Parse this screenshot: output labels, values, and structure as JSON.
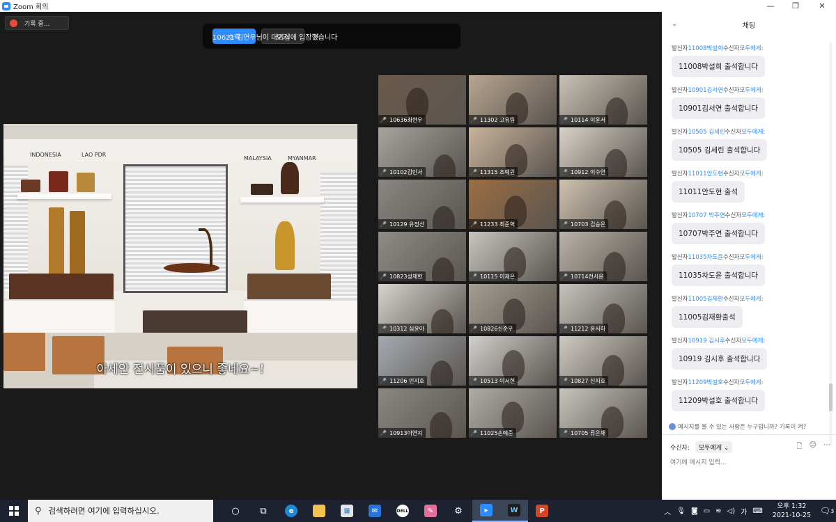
{
  "window": {
    "title": "Zoom 회의",
    "minimize": "—",
    "maximize": "❐",
    "close": "✕"
  },
  "recording": {
    "label": "기록 중..."
  },
  "waiting_room": {
    "message": "10621 김연우님이 대기실에 입장했습니다",
    "admit_label": "수락",
    "view_label": "보기",
    "close": "×"
  },
  "shared_screen": {
    "labels": [
      "INDONESIA",
      "LAO PDR",
      "MALAYSIA",
      "MYANMAR"
    ],
    "caption": "아세안 전시품이 있으니 좋네요~!"
  },
  "participants": [
    {
      "name": "10636최현우",
      "bg": "#6b5a4a"
    },
    {
      "name": "11302 고유림",
      "bg": "#b7a58f"
    },
    {
      "name": "10114 이윤서",
      "bg": "#c9c2b5"
    },
    {
      "name": "10102김민서",
      "bg": "#a7a39d"
    },
    {
      "name": "11315 조예원",
      "bg": "#c9b39a"
    },
    {
      "name": "10912 이수연",
      "bg": "#d8d2c8"
    },
    {
      "name": "10129 유정선",
      "bg": "#8a8782"
    },
    {
      "name": "11233 최준혁",
      "bg": "#9c6d42"
    },
    {
      "name": "10703 김승은",
      "bg": "#cfc2b0"
    },
    {
      "name": "10823성재현",
      "bg": "#8f8c86"
    },
    {
      "name": "10115 이채은",
      "bg": "#c7c4bd"
    },
    {
      "name": "10714전서윤",
      "bg": "#b9b2a8"
    },
    {
      "name": "10312 심윤아",
      "bg": "#d7d3cd"
    },
    {
      "name": "10826신준우",
      "bg": "#a49d92"
    },
    {
      "name": "11212 윤서하",
      "bg": "#c6c2bc"
    },
    {
      "name": "11206 민지호",
      "bg": "#a5aab1"
    },
    {
      "name": "10513 이서현",
      "bg": "#d2d0cc"
    },
    {
      "name": "10827 신지호",
      "bg": "#cfcac3"
    },
    {
      "name": "10913이연지",
      "bg": "#8b8781"
    },
    {
      "name": "11025손예준",
      "bg": "#b0aca6"
    },
    {
      "name": "10705 류은채",
      "bg": "#c8c4bd"
    }
  ],
  "chat": {
    "title": "채팅",
    "collapse_icon": "⌄",
    "messages": [
      {
        "prefix": "발신자",
        "sender": "11008박설희",
        "mid": "수신자",
        "recipient": "모두에게",
        "suffix": ":",
        "text": "11008박설희 출석합니다"
      },
      {
        "prefix": "발신자",
        "sender": "10901김서연",
        "mid": "수신자",
        "recipient": "모두에게",
        "suffix": ":",
        "text": "10901김서연 출석합니다"
      },
      {
        "prefix": "발신자",
        "sender": "10505 김세린",
        "mid": "수신자",
        "recipient": "모두에게",
        "suffix": ":",
        "text": "10505 김세린 출석합니다"
      },
      {
        "prefix": "발신자",
        "sender": "11011안도현",
        "mid": "수신자",
        "recipient": "모두에게",
        "suffix": ":",
        "text": "11011안도현 출석"
      },
      {
        "prefix": "발신자",
        "sender": "10707 박주연",
        "mid": "수신자",
        "recipient": "모두에게",
        "suffix": ":",
        "text": "10707박주연 출석합니다"
      },
      {
        "prefix": "발신자",
        "sender": "11035차도윤",
        "mid": "수신자",
        "recipient": "모두에게",
        "suffix": ":",
        "text": "11035차도윤 출석합니다"
      },
      {
        "prefix": "발신자",
        "sender": "11005김재환",
        "mid": "수신자",
        "recipient": "모두에게",
        "suffix": ":",
        "text": "11005김재환출석"
      },
      {
        "prefix": "발신자",
        "sender": "10919 김시후",
        "mid": "수신자",
        "recipient": "모두에게",
        "suffix": ":",
        "text": "10919 김시후 출석합니다"
      },
      {
        "prefix": "발신자",
        "sender": "11209박설호",
        "mid": "수신자",
        "recipient": "모두에게",
        "suffix": ":",
        "text": "11209박설호 출석합니다"
      }
    ],
    "privacy_note": "메시지를 볼 수 있는 사람은 누구입니까? 기록이 켜?",
    "to_label": "수신자:",
    "to_value": "모두에게 ⌄",
    "input_placeholder": "여기에 메시지 입력...",
    "tool_icons": [
      "🗋",
      "☺",
      "⋯"
    ]
  },
  "taskbar": {
    "search_placeholder": "검색하려면 여기에 입력하십시오.",
    "ime": "가",
    "time": "오후 1:32",
    "date": "2021-10-25",
    "notification_count": "3"
  }
}
